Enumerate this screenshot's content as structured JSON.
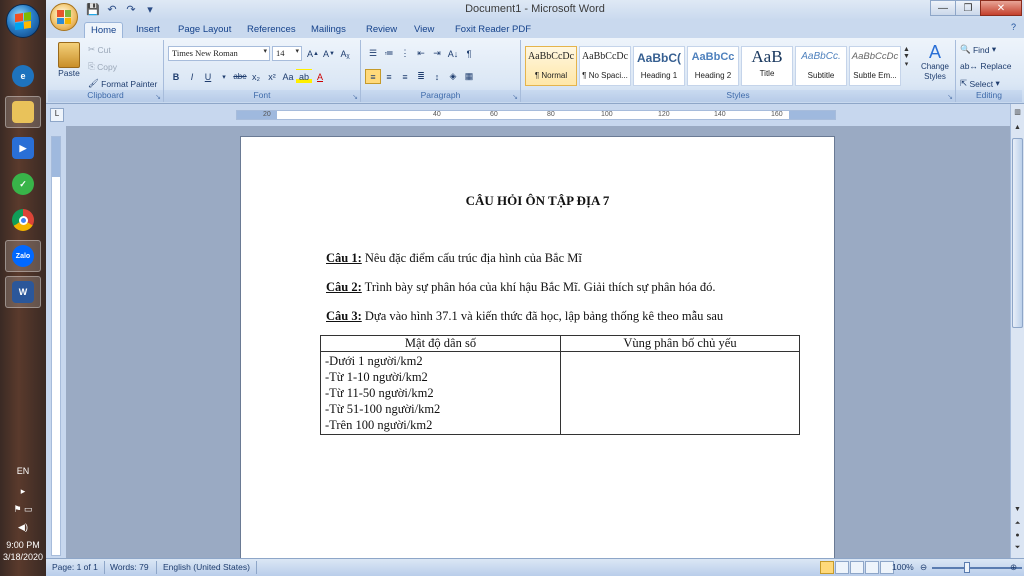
{
  "window": {
    "title": "Document1 - Microsoft Word"
  },
  "tabs": [
    "Home",
    "Insert",
    "Page Layout",
    "References",
    "Mailings",
    "Review",
    "View",
    "Foxit Reader PDF"
  ],
  "ribbon": {
    "clipboard": {
      "paste": "Paste",
      "cut": "Cut",
      "copy": "Copy",
      "format_painter": "Format Painter",
      "label": "Clipboard"
    },
    "font": {
      "font_name": "Times New Roman",
      "font_size": "14",
      "label": "Font"
    },
    "paragraph": {
      "label": "Paragraph"
    },
    "styles": {
      "items": [
        {
          "sample": "AaBbCcDc",
          "name": "¶ Normal"
        },
        {
          "sample": "AaBbCcDc",
          "name": "¶ No Spaci..."
        },
        {
          "sample": "AaBbC(",
          "name": "Heading 1"
        },
        {
          "sample": "AaBbCc",
          "name": "Heading 2"
        },
        {
          "sample": "AaB",
          "name": "Title"
        },
        {
          "sample": "AaBbCc.",
          "name": "Subtitle"
        },
        {
          "sample": "AaBbCcDc",
          "name": "Subtle Em..."
        }
      ],
      "change_styles": "Change Styles",
      "label": "Styles"
    },
    "editing": {
      "find": "Find",
      "replace": "Replace",
      "select": "Select",
      "label": "Editing"
    }
  },
  "ruler": {
    "ticks": [
      "20",
      "40",
      "60",
      "80",
      "100",
      "120",
      "140",
      "160"
    ]
  },
  "document": {
    "title": "CÂU HỎI ÔN TẬP ĐỊA 7",
    "questions": [
      {
        "label": "Câu 1:",
        "text": " Nêu đặc điểm cấu trúc địa hình của Bắc Mĩ"
      },
      {
        "label": "Câu 2:",
        "text": " Trình bày sự phân hóa của khí hậu Bắc Mĩ. Giải thích sự phân hóa đó."
      },
      {
        "label": "Câu 3:",
        "text": " Dựa vào hình 37.1 và kiến thức đã học, lập bảng thống kê theo mẫu sau"
      }
    ],
    "table": {
      "headers": [
        "Mật độ dân số",
        "Vùng phân bố chủ yếu"
      ],
      "rows": [
        "-Dưới 1 người/km2",
        "-Từ 1-10 người/km2",
        "-Từ 11-50 người/km2",
        "-Từ 51-100 người/km2",
        "-Trên 100 người/km2"
      ]
    }
  },
  "statusbar": {
    "page": "Page: 1 of 1",
    "words": "Words: 79",
    "language": "English (United States)",
    "zoom": "100%"
  },
  "taskbar": {
    "lang": "EN",
    "time": "9:00 PM",
    "date": "3/18/2020",
    "apps": [
      "Internet Explorer",
      "File Explorer",
      "Media Player",
      "Green App",
      "Chrome",
      "Zalo",
      "Word"
    ]
  },
  "colors": {
    "accent": "#15428b",
    "ribbon": "#dbe7f5"
  }
}
